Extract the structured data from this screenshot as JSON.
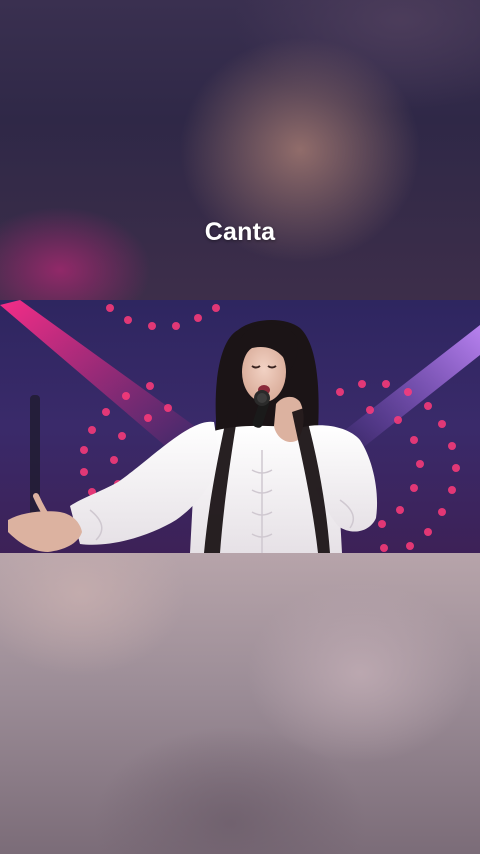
{
  "story": {
    "caption": "Canta"
  },
  "colors": {
    "stage_background": "#2e2660",
    "stage_light_pink": "#ff2d8a",
    "stage_light_purple": "#b06cff",
    "led_dots": "#ff3b7a",
    "blouse": "#f2eef0",
    "hair": "#1b1416",
    "microphone": "#1a1a1a"
  },
  "icons": {
    "microphone": "microphone-icon"
  }
}
